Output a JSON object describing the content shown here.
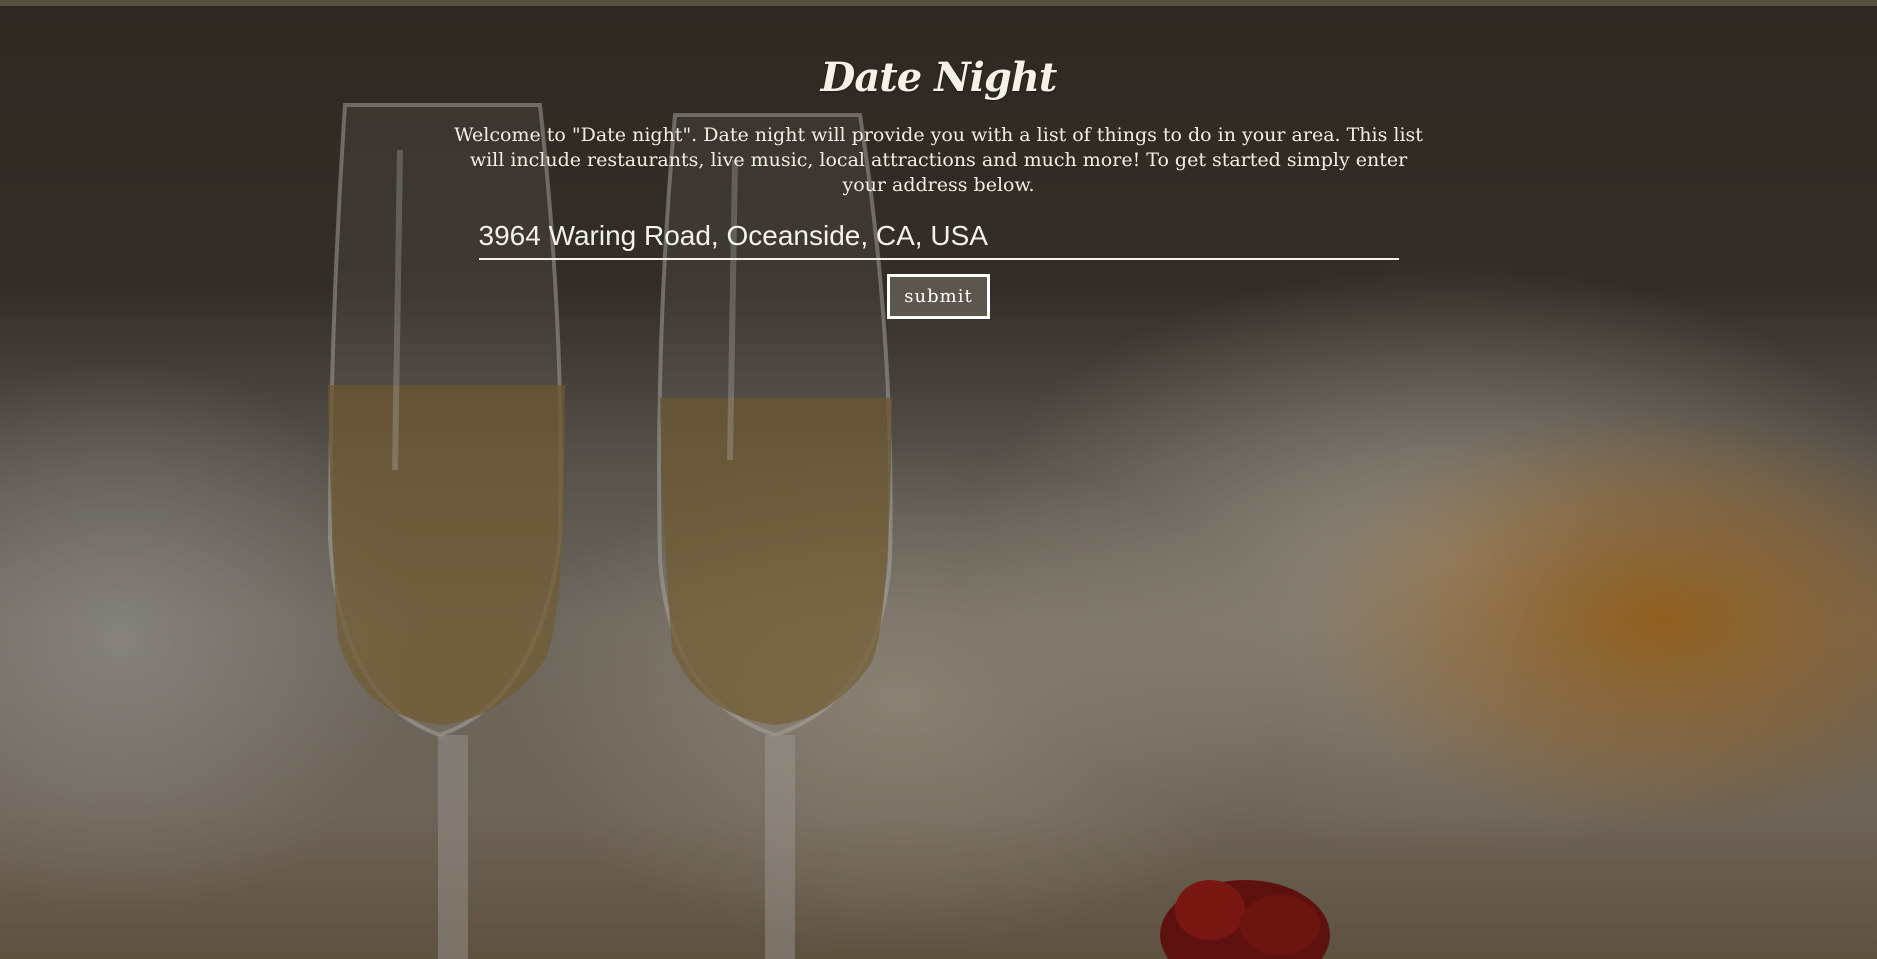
{
  "page": {
    "title": "Date Night",
    "intro": "Welcome to \"Date night\". Date night will provide you with a list of things to do in your area. This list will include restaurants, live music, local attractions and much more! To get started simply enter your address below."
  },
  "address": {
    "value": "3964 Waring Road, Oceanside, CA, USA",
    "placeholder": ""
  },
  "form": {
    "submit_label": "submit"
  },
  "background": {
    "description_icon": "champagne-flutes-rose-photo-icon"
  },
  "colors": {
    "text": "#f6f1e6",
    "input_underline": "#f4f1ea",
    "button_border": "#ffffff",
    "accent_orange": "#c47814"
  }
}
